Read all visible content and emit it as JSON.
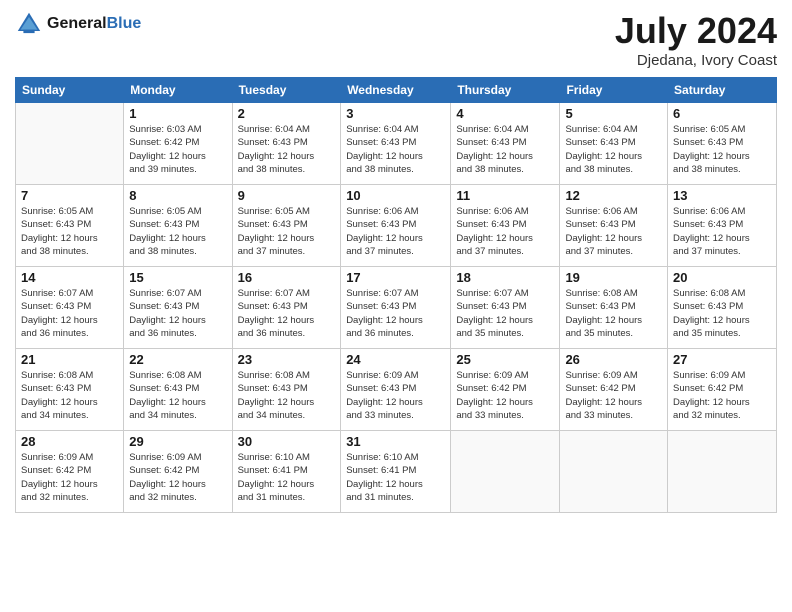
{
  "header": {
    "logo_general": "General",
    "logo_blue": "Blue",
    "title": "July 2024",
    "location": "Djedana, Ivory Coast"
  },
  "weekdays": [
    "Sunday",
    "Monday",
    "Tuesday",
    "Wednesday",
    "Thursday",
    "Friday",
    "Saturday"
  ],
  "weeks": [
    [
      {
        "day": "",
        "sunrise": "",
        "sunset": "",
        "daylight": ""
      },
      {
        "day": "1",
        "sunrise": "Sunrise: 6:03 AM",
        "sunset": "Sunset: 6:42 PM",
        "daylight": "Daylight: 12 hours and 39 minutes."
      },
      {
        "day": "2",
        "sunrise": "Sunrise: 6:04 AM",
        "sunset": "Sunset: 6:43 PM",
        "daylight": "Daylight: 12 hours and 38 minutes."
      },
      {
        "day": "3",
        "sunrise": "Sunrise: 6:04 AM",
        "sunset": "Sunset: 6:43 PM",
        "daylight": "Daylight: 12 hours and 38 minutes."
      },
      {
        "day": "4",
        "sunrise": "Sunrise: 6:04 AM",
        "sunset": "Sunset: 6:43 PM",
        "daylight": "Daylight: 12 hours and 38 minutes."
      },
      {
        "day": "5",
        "sunrise": "Sunrise: 6:04 AM",
        "sunset": "Sunset: 6:43 PM",
        "daylight": "Daylight: 12 hours and 38 minutes."
      },
      {
        "day": "6",
        "sunrise": "Sunrise: 6:05 AM",
        "sunset": "Sunset: 6:43 PM",
        "daylight": "Daylight: 12 hours and 38 minutes."
      }
    ],
    [
      {
        "day": "7",
        "sunrise": "Sunrise: 6:05 AM",
        "sunset": "Sunset: 6:43 PM",
        "daylight": "Daylight: 12 hours and 38 minutes."
      },
      {
        "day": "8",
        "sunrise": "Sunrise: 6:05 AM",
        "sunset": "Sunset: 6:43 PM",
        "daylight": "Daylight: 12 hours and 38 minutes."
      },
      {
        "day": "9",
        "sunrise": "Sunrise: 6:05 AM",
        "sunset": "Sunset: 6:43 PM",
        "daylight": "Daylight: 12 hours and 37 minutes."
      },
      {
        "day": "10",
        "sunrise": "Sunrise: 6:06 AM",
        "sunset": "Sunset: 6:43 PM",
        "daylight": "Daylight: 12 hours and 37 minutes."
      },
      {
        "day": "11",
        "sunrise": "Sunrise: 6:06 AM",
        "sunset": "Sunset: 6:43 PM",
        "daylight": "Daylight: 12 hours and 37 minutes."
      },
      {
        "day": "12",
        "sunrise": "Sunrise: 6:06 AM",
        "sunset": "Sunset: 6:43 PM",
        "daylight": "Daylight: 12 hours and 37 minutes."
      },
      {
        "day": "13",
        "sunrise": "Sunrise: 6:06 AM",
        "sunset": "Sunset: 6:43 PM",
        "daylight": "Daylight: 12 hours and 37 minutes."
      }
    ],
    [
      {
        "day": "14",
        "sunrise": "Sunrise: 6:07 AM",
        "sunset": "Sunset: 6:43 PM",
        "daylight": "Daylight: 12 hours and 36 minutes."
      },
      {
        "day": "15",
        "sunrise": "Sunrise: 6:07 AM",
        "sunset": "Sunset: 6:43 PM",
        "daylight": "Daylight: 12 hours and 36 minutes."
      },
      {
        "day": "16",
        "sunrise": "Sunrise: 6:07 AM",
        "sunset": "Sunset: 6:43 PM",
        "daylight": "Daylight: 12 hours and 36 minutes."
      },
      {
        "day": "17",
        "sunrise": "Sunrise: 6:07 AM",
        "sunset": "Sunset: 6:43 PM",
        "daylight": "Daylight: 12 hours and 36 minutes."
      },
      {
        "day": "18",
        "sunrise": "Sunrise: 6:07 AM",
        "sunset": "Sunset: 6:43 PM",
        "daylight": "Daylight: 12 hours and 35 minutes."
      },
      {
        "day": "19",
        "sunrise": "Sunrise: 6:08 AM",
        "sunset": "Sunset: 6:43 PM",
        "daylight": "Daylight: 12 hours and 35 minutes."
      },
      {
        "day": "20",
        "sunrise": "Sunrise: 6:08 AM",
        "sunset": "Sunset: 6:43 PM",
        "daylight": "Daylight: 12 hours and 35 minutes."
      }
    ],
    [
      {
        "day": "21",
        "sunrise": "Sunrise: 6:08 AM",
        "sunset": "Sunset: 6:43 PM",
        "daylight": "Daylight: 12 hours and 34 minutes."
      },
      {
        "day": "22",
        "sunrise": "Sunrise: 6:08 AM",
        "sunset": "Sunset: 6:43 PM",
        "daylight": "Daylight: 12 hours and 34 minutes."
      },
      {
        "day": "23",
        "sunrise": "Sunrise: 6:08 AM",
        "sunset": "Sunset: 6:43 PM",
        "daylight": "Daylight: 12 hours and 34 minutes."
      },
      {
        "day": "24",
        "sunrise": "Sunrise: 6:09 AM",
        "sunset": "Sunset: 6:43 PM",
        "daylight": "Daylight: 12 hours and 33 minutes."
      },
      {
        "day": "25",
        "sunrise": "Sunrise: 6:09 AM",
        "sunset": "Sunset: 6:42 PM",
        "daylight": "Daylight: 12 hours and 33 minutes."
      },
      {
        "day": "26",
        "sunrise": "Sunrise: 6:09 AM",
        "sunset": "Sunset: 6:42 PM",
        "daylight": "Daylight: 12 hours and 33 minutes."
      },
      {
        "day": "27",
        "sunrise": "Sunrise: 6:09 AM",
        "sunset": "Sunset: 6:42 PM",
        "daylight": "Daylight: 12 hours and 32 minutes."
      }
    ],
    [
      {
        "day": "28",
        "sunrise": "Sunrise: 6:09 AM",
        "sunset": "Sunset: 6:42 PM",
        "daylight": "Daylight: 12 hours and 32 minutes."
      },
      {
        "day": "29",
        "sunrise": "Sunrise: 6:09 AM",
        "sunset": "Sunset: 6:42 PM",
        "daylight": "Daylight: 12 hours and 32 minutes."
      },
      {
        "day": "30",
        "sunrise": "Sunrise: 6:10 AM",
        "sunset": "Sunset: 6:41 PM",
        "daylight": "Daylight: 12 hours and 31 minutes."
      },
      {
        "day": "31",
        "sunrise": "Sunrise: 6:10 AM",
        "sunset": "Sunset: 6:41 PM",
        "daylight": "Daylight: 12 hours and 31 minutes."
      },
      {
        "day": "",
        "sunrise": "",
        "sunset": "",
        "daylight": ""
      },
      {
        "day": "",
        "sunrise": "",
        "sunset": "",
        "daylight": ""
      },
      {
        "day": "",
        "sunrise": "",
        "sunset": "",
        "daylight": ""
      }
    ]
  ]
}
